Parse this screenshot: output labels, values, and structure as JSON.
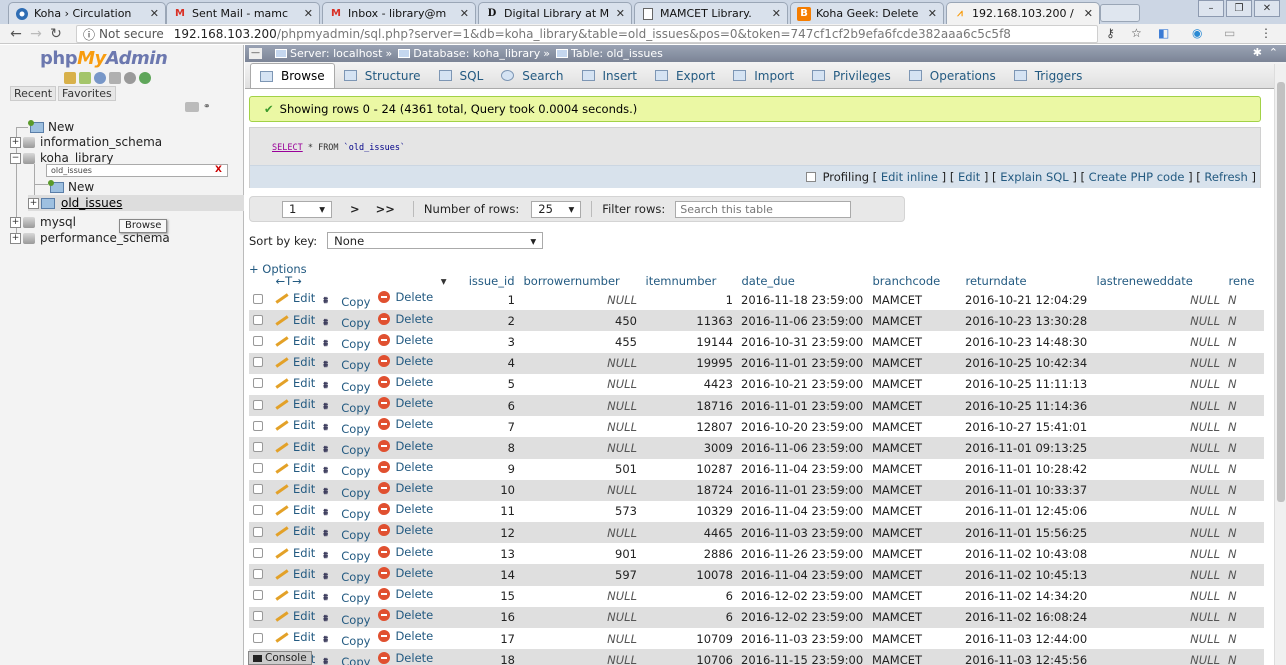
{
  "browser": {
    "tabs": [
      {
        "title": "Koha › Circulation",
        "favicon": "koha-icon",
        "color": "#2e6db4"
      },
      {
        "title": "Sent Mail - mamc",
        "favicon": "gmail-icon",
        "color": "#d93025"
      },
      {
        "title": "Inbox - library@m",
        "favicon": "gmail-icon",
        "color": "#d93025"
      },
      {
        "title": "Digital Library at M",
        "favicon": "d-icon",
        "color": "#111111"
      },
      {
        "title": "MAMCET Library.",
        "favicon": "page-icon",
        "color": "#666666"
      },
      {
        "title": "Koha Geek: Delete",
        "favicon": "blogger-icon",
        "color": "#f57d00"
      },
      {
        "title": "192.168.103.200 /",
        "favicon": "pma-icon",
        "color": "#f89c0e"
      }
    ],
    "url_security": "Not secure",
    "url_host": "192.168.103.200",
    "url_path": "/phpmyadmin/sql.php?server=1&db=koha_library&table=old_issues&pos=0&token=747cf1cf2b9efa6fcde382aaa6c5c5f8"
  },
  "left": {
    "logo_php": "php",
    "logo_my": "My",
    "logo_admin": "Admin",
    "recent": "Recent",
    "favorites": "Favorites",
    "tree": {
      "new": "New",
      "db1": "information_schema",
      "db2": "koha_library",
      "filter": "old_issues",
      "new2": "New",
      "table": "old_issues",
      "db3": "mysql",
      "db4": "performance_schema"
    },
    "tooltip": "Browse"
  },
  "breadcrumb": {
    "server": "Server: localhost",
    "database": "Database: koha_library",
    "table": "Table: old_issues"
  },
  "tabs": [
    "Browse",
    "Structure",
    "SQL",
    "Search",
    "Insert",
    "Export",
    "Import",
    "Privileges",
    "Operations",
    "Triggers"
  ],
  "message": "Showing rows 0 - 24 (4361 total, Query took 0.0004 seconds.)",
  "sql": {
    "select": "SELECT",
    "star": " * FROM ",
    "table": "`old_issues`"
  },
  "sqlbar": {
    "profiling": "Profiling",
    "links": [
      "Edit inline",
      "Edit",
      "Explain SQL",
      "Create PHP code",
      "Refresh"
    ]
  },
  "nav": {
    "page": "1",
    "next": ">",
    "last": ">>",
    "rows_label": "Number of rows:",
    "rows_value": "25",
    "filter_label": "Filter rows:",
    "filter_placeholder": "Search this table"
  },
  "sort": {
    "label": "Sort by key:",
    "value": "None"
  },
  "options_label": "+ Options",
  "actions": {
    "edit": "Edit",
    "copy": "Copy",
    "delete": "Delete"
  },
  "columns": [
    "issue_id",
    "borrowernumber",
    "itemnumber",
    "date_due",
    "branchcode",
    "returndate",
    "lastreneweddate",
    "rene"
  ],
  "rows": [
    [
      "1",
      "NULL",
      "1",
      "2016-11-18 23:59:00",
      "MAMCET",
      "2016-10-21 12:04:29",
      "NULL",
      "N"
    ],
    [
      "2",
      "450",
      "11363",
      "2016-11-06 23:59:00",
      "MAMCET",
      "2016-10-23 13:30:28",
      "NULL",
      "N"
    ],
    [
      "3",
      "455",
      "19144",
      "2016-10-31 23:59:00",
      "MAMCET",
      "2016-10-23 14:48:30",
      "NULL",
      "N"
    ],
    [
      "4",
      "NULL",
      "19995",
      "2016-11-01 23:59:00",
      "MAMCET",
      "2016-10-25 10:42:34",
      "NULL",
      "N"
    ],
    [
      "5",
      "NULL",
      "4423",
      "2016-10-21 23:59:00",
      "MAMCET",
      "2016-10-25 11:11:13",
      "NULL",
      "N"
    ],
    [
      "6",
      "NULL",
      "18716",
      "2016-11-01 23:59:00",
      "MAMCET",
      "2016-10-25 11:14:36",
      "NULL",
      "N"
    ],
    [
      "7",
      "NULL",
      "12807",
      "2016-10-20 23:59:00",
      "MAMCET",
      "2016-10-27 15:41:01",
      "NULL",
      "N"
    ],
    [
      "8",
      "NULL",
      "3009",
      "2016-11-06 23:59:00",
      "MAMCET",
      "2016-11-01 09:13:25",
      "NULL",
      "N"
    ],
    [
      "9",
      "501",
      "10287",
      "2016-11-04 23:59:00",
      "MAMCET",
      "2016-11-01 10:28:42",
      "NULL",
      "N"
    ],
    [
      "10",
      "NULL",
      "18724",
      "2016-11-01 23:59:00",
      "MAMCET",
      "2016-11-01 10:33:37",
      "NULL",
      "N"
    ],
    [
      "11",
      "573",
      "10329",
      "2016-11-04 23:59:00",
      "MAMCET",
      "2016-11-01 12:45:06",
      "NULL",
      "N"
    ],
    [
      "12",
      "NULL",
      "4465",
      "2016-11-03 23:59:00",
      "MAMCET",
      "2016-11-01 15:56:25",
      "NULL",
      "N"
    ],
    [
      "13",
      "901",
      "2886",
      "2016-11-26 23:59:00",
      "MAMCET",
      "2016-11-02 10:43:08",
      "NULL",
      "N"
    ],
    [
      "14",
      "597",
      "10078",
      "2016-11-04 23:59:00",
      "MAMCET",
      "2016-11-02 10:45:13",
      "NULL",
      "N"
    ],
    [
      "15",
      "NULL",
      "6",
      "2016-12-02 23:59:00",
      "MAMCET",
      "2016-11-02 14:34:20",
      "NULL",
      "N"
    ],
    [
      "16",
      "NULL",
      "6",
      "2016-12-02 23:59:00",
      "MAMCET",
      "2016-11-02 16:08:24",
      "NULL",
      "N"
    ],
    [
      "17",
      "NULL",
      "10709",
      "2016-11-03 23:59:00",
      "MAMCET",
      "2016-11-03 12:44:00",
      "NULL",
      "N"
    ],
    [
      "18",
      "NULL",
      "10706",
      "2016-11-15 23:59:00",
      "MAMCET",
      "2016-11-03 12:45:56",
      "NULL",
      "N"
    ]
  ],
  "console_label": "Console",
  "colors": {
    "link": "#235a81",
    "success_bg": "#ebf8a4",
    "row_alt": "#dfdfdf"
  }
}
